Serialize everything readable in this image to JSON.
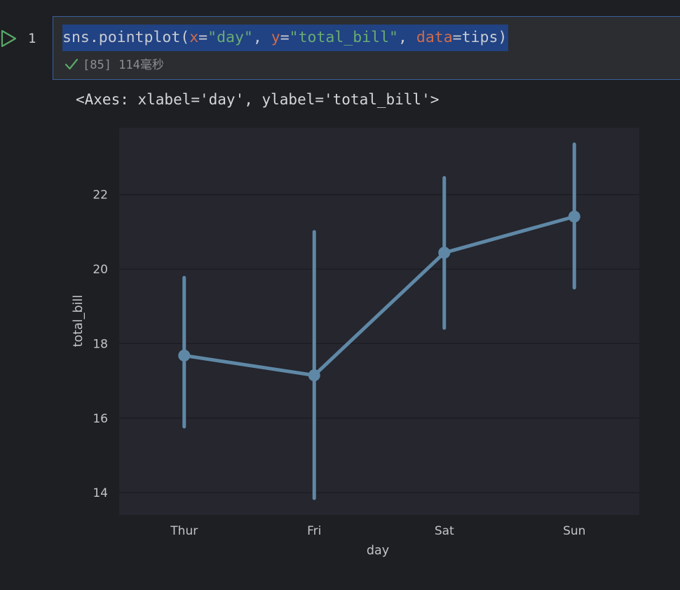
{
  "editor": {
    "line_number": "1",
    "code": {
      "t1": "sns.pointplot(",
      "t2": "x",
      "t3": "=",
      "t4": "\"day\"",
      "t5": ", ",
      "t6": "y",
      "t7": "=",
      "t8": "\"total_bill\"",
      "t9": ", ",
      "t10": "data",
      "t11": "=tips)"
    },
    "exec_status": "[85] 114毫秒",
    "run_icon": "play-triangle-icon",
    "status_icon": "check-icon"
  },
  "output": {
    "repr": "<Axes: xlabel='day', ylabel='total_bill'>"
  },
  "colors": {
    "background": "#1e1f22",
    "cell_background": "#2b2d31",
    "selection": "#214283",
    "plot_area": "#25262e",
    "line": "#5f88a6",
    "run_green": "#59a869"
  },
  "chart_data": {
    "type": "line",
    "xlabel": "day",
    "ylabel": "total_bill",
    "categories": [
      "Thur",
      "Fri",
      "Sat",
      "Sun"
    ],
    "series": [
      {
        "values": [
          17.68,
          17.15,
          20.44,
          21.41
        ],
        "ci_low": [
          15.77,
          13.85,
          18.42,
          19.5
        ],
        "ci_high": [
          19.77,
          21.0,
          22.45,
          23.35
        ]
      }
    ],
    "yticks": [
      "14",
      "16",
      "18",
      "20",
      "22"
    ],
    "ylim": [
      13.4,
      23.8
    ],
    "grid": true
  }
}
